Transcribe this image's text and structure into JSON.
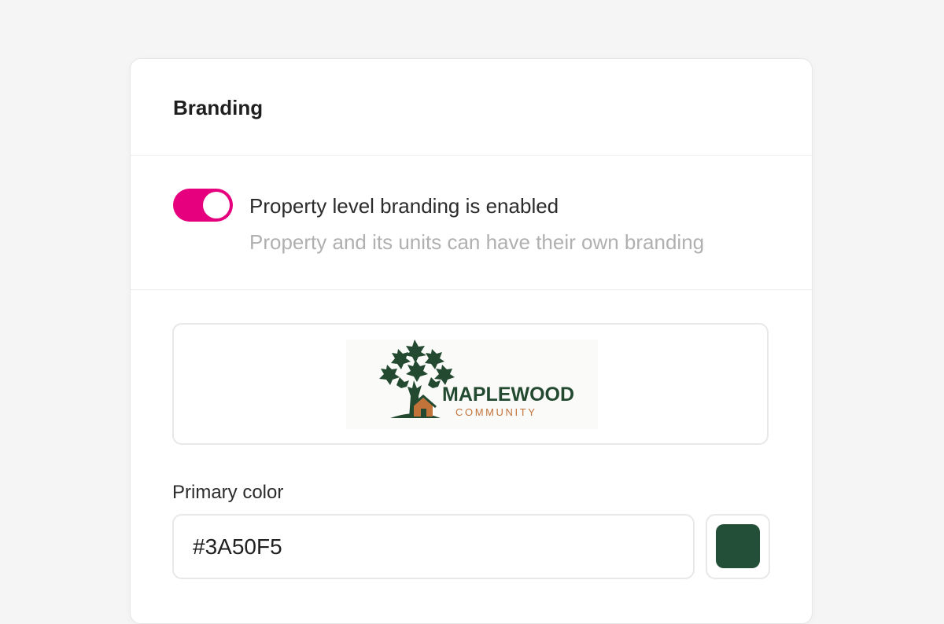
{
  "section": {
    "title": "Branding"
  },
  "toggle": {
    "enabled": true,
    "label": "Property level branding is enabled",
    "description": "Property and its units can have their own branding",
    "color": "#e6007e"
  },
  "logo": {
    "name": "MAPLEWOOD",
    "subtitle": "COMMUNITY",
    "tree_color": "#234a31",
    "accent_color": "#c2733a"
  },
  "primary_color": {
    "label": "Primary color",
    "value": "#3A50F5",
    "swatch_color": "#234f38"
  }
}
